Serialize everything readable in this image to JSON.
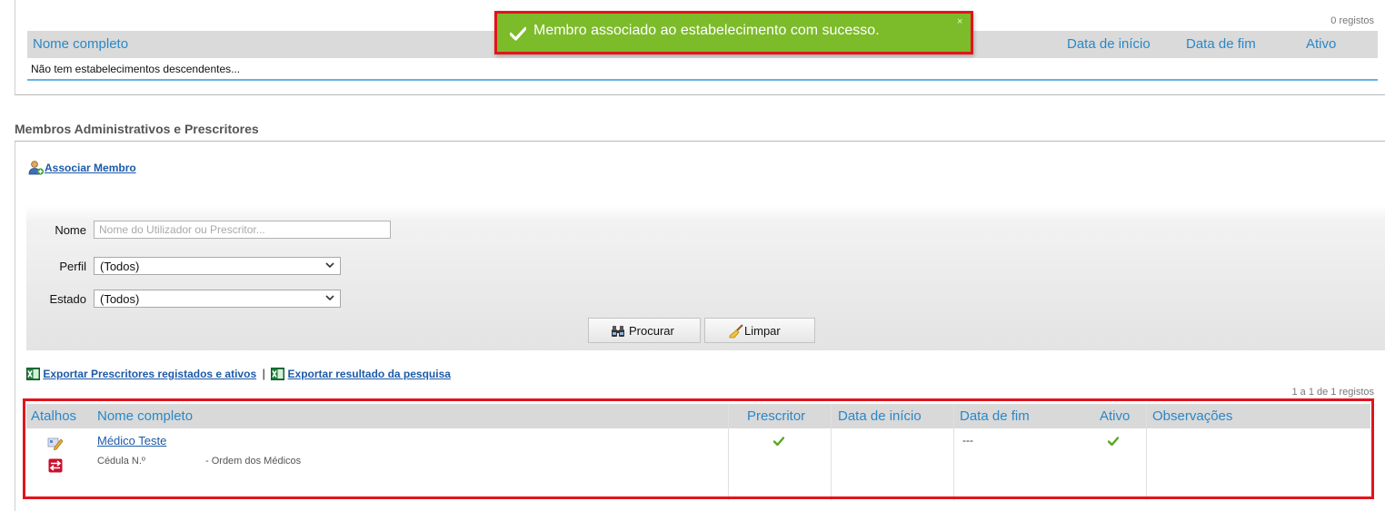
{
  "descendants": {
    "count_text": "0 registos",
    "columns": [
      "Nome completo",
      "Data de início",
      "Data de fim",
      "Ativo"
    ],
    "empty_message": "Não tem estabelecimentos descendentes..."
  },
  "toast": {
    "message": "Membro associado ao estabelecimento com sucesso.",
    "close": "×",
    "color": "#7cbb29",
    "border_color": "#e3131c"
  },
  "members": {
    "title": "Membros Administrativos e Prescritores",
    "associate_label": "Associar Membro",
    "filter": {
      "name_label": "Nome",
      "name_placeholder": "Nome do Utilizador ou Prescritor...",
      "name_value": "",
      "profile_label": "Perfil",
      "profile_value": "(Todos)",
      "status_label": "Estado",
      "status_value": "(Todos)",
      "search_button": "Procurar",
      "clear_button": "Limpar"
    },
    "exports": {
      "registered_link": "Exportar Prescritores registados e ativos",
      "separator": "|",
      "results_link": "Exportar resultado da pesquisa"
    },
    "count_text": "1 a 1 de 1 registos",
    "table": {
      "columns": [
        "Atalhos",
        "Nome completo",
        "Prescritor",
        "Data de início",
        "Data de fim",
        "Ativo",
        "Observações"
      ],
      "rows": [
        {
          "name": "Médico Teste",
          "cedula_label": "Cédula N.º",
          "order": "- Ordem dos Médicos",
          "prescriber": "check",
          "start_date": "",
          "end_date": "---",
          "active": "check",
          "notes": ""
        }
      ]
    }
  },
  "accent_color": "#2a88c8",
  "link_color": "#1d5aa8",
  "highlight_color": "#e3131c"
}
